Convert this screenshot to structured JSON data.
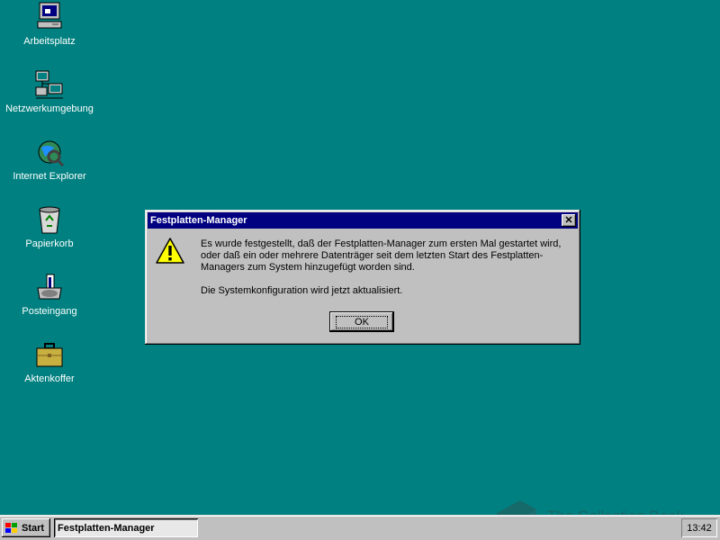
{
  "desktop": {
    "icons": [
      {
        "label": "Arbeitsplatz",
        "icon": "computer-icon"
      },
      {
        "label": "Netzwerkumgebung",
        "icon": "network-icon"
      },
      {
        "label": "Internet Explorer",
        "icon": "internet-explorer-icon"
      },
      {
        "label": "Papierkorb",
        "icon": "recycle-bin-icon"
      },
      {
        "label": "Posteingang",
        "icon": "inbox-icon"
      },
      {
        "label": "Aktenkoffer",
        "icon": "briefcase-icon"
      }
    ]
  },
  "dialog": {
    "title": "Festplatten-Manager",
    "close_label": "✕",
    "icon": "warning-icon",
    "message_1": "Es wurde festgestellt, daß der Festplatten-Manager zum ersten Mal gestartet wird, oder daß ein oder mehrere Datenträger seit dem letzten Start des Festplatten-Managers zum System hinzugefügt worden sind.",
    "message_2": "Die Systemkonfiguration wird jetzt aktualisiert.",
    "ok_label": "OK"
  },
  "taskbar": {
    "start_label": "Start",
    "task_label": "Festplatten-Manager",
    "clock": "13:42"
  },
  "watermark": {
    "text": "The Collection Book"
  },
  "colors": {
    "desktop": "#008080",
    "titlebar": "#000080",
    "face": "#c0c0c0"
  }
}
